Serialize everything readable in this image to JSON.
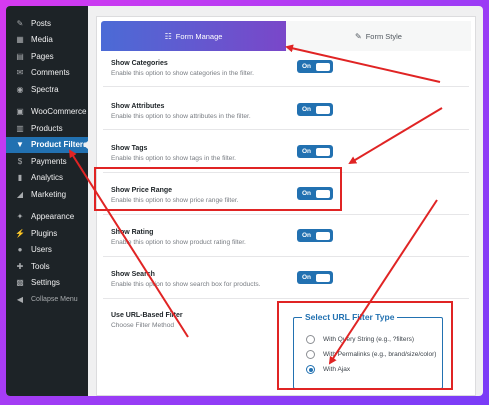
{
  "sidebar": {
    "items": [
      {
        "label": "Posts",
        "icon": "pin-icon",
        "glyph": "✎"
      },
      {
        "label": "Media",
        "icon": "media-icon",
        "glyph": "▦"
      },
      {
        "label": "Pages",
        "icon": "pages-icon",
        "glyph": "▤"
      },
      {
        "label": "Comments",
        "icon": "comments-icon",
        "glyph": "✉"
      },
      {
        "label": "Spectra",
        "icon": "spectra-icon",
        "glyph": "◉"
      },
      {
        "label": "WooCommerce",
        "icon": "woocommerce-icon",
        "glyph": "▣"
      },
      {
        "label": "Products",
        "icon": "products-icon",
        "glyph": "▥"
      },
      {
        "label": "Product Filters",
        "icon": "filter-icon",
        "glyph": "▼"
      },
      {
        "label": "Payments",
        "icon": "payments-icon",
        "glyph": "$"
      },
      {
        "label": "Analytics",
        "icon": "analytics-icon",
        "glyph": "▮"
      },
      {
        "label": "Marketing",
        "icon": "marketing-icon",
        "glyph": "◢"
      },
      {
        "label": "Appearance",
        "icon": "appearance-icon",
        "glyph": "✦"
      },
      {
        "label": "Plugins",
        "icon": "plugins-icon",
        "glyph": "⚡"
      },
      {
        "label": "Users",
        "icon": "users-icon",
        "glyph": "●"
      },
      {
        "label": "Tools",
        "icon": "tools-icon",
        "glyph": "✚"
      },
      {
        "label": "Settings",
        "icon": "settings-icon",
        "glyph": "▩"
      },
      {
        "label": "Collapse Menu",
        "icon": "collapse-icon",
        "glyph": "◀"
      }
    ]
  },
  "tabs": {
    "form_manage": "Form Manage",
    "form_style": "Form Style"
  },
  "settings": [
    {
      "title": "Show Categories",
      "desc": "Enable this option to show categories in the filter.",
      "toggle": "On"
    },
    {
      "title": "Show Attributes",
      "desc": "Enable this option to show attributes in the filter.",
      "toggle": "On"
    },
    {
      "title": "Show Tags",
      "desc": "Enable this option to show tags in the filter.",
      "toggle": "On"
    },
    {
      "title": "Show Price Range",
      "desc": "Enable this option to show price range filter.",
      "toggle": "On"
    },
    {
      "title": "Show Rating",
      "desc": "Enable this option to show product rating filter.",
      "toggle": "On"
    },
    {
      "title": "Show Search",
      "desc": "Enable this option to show search box for products.",
      "toggle": "On"
    }
  ],
  "url_filter": {
    "title": "Use URL-Based Filter",
    "desc": "Choose Filter Method",
    "box_title": "Select URL Filter Type",
    "options": [
      "With Query String (e.g., ?filters)",
      "With Permalinks (e.g., brand/size/color)",
      "With Ajax"
    ],
    "selected_index": 2
  },
  "colors": {
    "accent": "#2271b1",
    "highlight": "#e02424"
  }
}
